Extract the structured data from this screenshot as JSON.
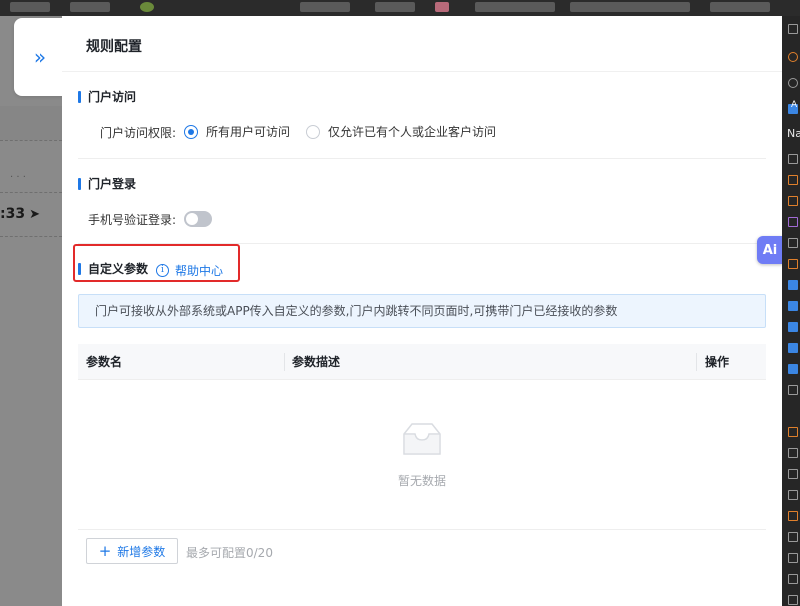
{
  "drawer": {
    "title": "规则配置",
    "expand_glyph": "»"
  },
  "background_app": {
    "time_text": ":33",
    "nav_glyph": "➤",
    "dots": "· · ·"
  },
  "sections": {
    "portal_access": {
      "title": "门户访问",
      "permission_label": "门户访问权限:",
      "options": [
        {
          "label": "所有用户可访问",
          "selected": true
        },
        {
          "label": "仅允许已有个人或企业客户访问",
          "selected": false
        }
      ]
    },
    "portal_login": {
      "title": "门户登录",
      "phone_verify_label": "手机号验证登录:",
      "phone_verify_enabled": false
    },
    "custom_params": {
      "title": "自定义参数",
      "help_link": "帮助中心",
      "help_icon": "i",
      "notice": "门户可接收从外部系统或APP传入自定义的参数,门户内跳转不同页面时,可携带门户已经接收的参数",
      "table": {
        "columns": [
          "参数名",
          "参数描述",
          "操作"
        ],
        "rows": [],
        "empty_text": "暂无数据"
      },
      "add_button": "新增参数",
      "add_icon": "+",
      "limit_text": "最多可配置0/20"
    }
  },
  "devtools": {
    "label_a": "A",
    "label_na": "Na"
  },
  "ai_assistant": {
    "label": "Ai"
  },
  "colors": {
    "accent": "#1e78e6",
    "highlight_border": "#e22a2a",
    "notice_bg": "#edf5fe",
    "ai_button": "#6f7cf5"
  }
}
